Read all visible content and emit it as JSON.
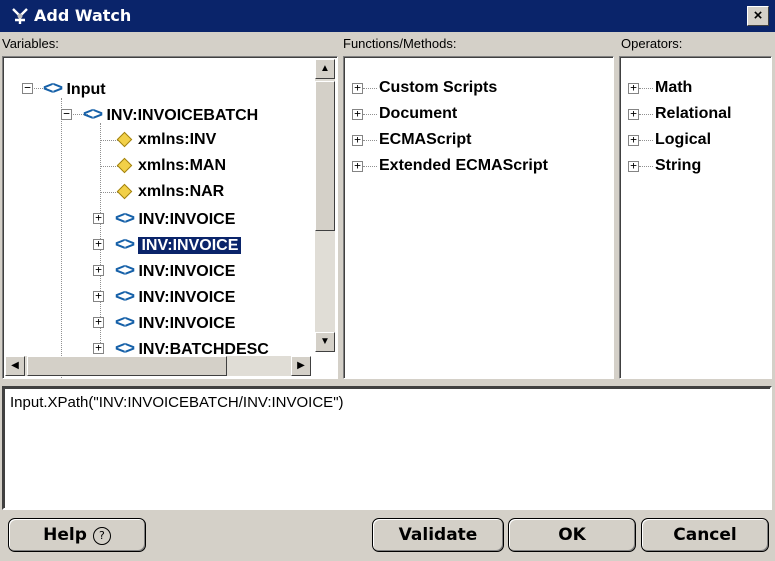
{
  "window": {
    "title": "Add Watch",
    "close_label": "×"
  },
  "variables": {
    "label": "Variables:",
    "tree": [
      {
        "icon": "tag-icon",
        "label": "Input",
        "expander": "−",
        "selected": false
      },
      {
        "icon": "tag-icon",
        "label": "INV:INVOICEBATCH",
        "expander": "−",
        "selected": false
      },
      {
        "icon": "attribute-icon",
        "label": "xmlns:INV",
        "expander": "",
        "selected": false
      },
      {
        "icon": "attribute-icon",
        "label": "xmlns:MAN",
        "expander": "",
        "selected": false
      },
      {
        "icon": "attribute-icon",
        "label": "xmlns:NAR",
        "expander": "",
        "selected": false
      },
      {
        "icon": "tag-icon",
        "label": "INV:INVOICE",
        "expander": "+",
        "selected": false
      },
      {
        "icon": "tag-icon",
        "label": "INV:INVOICE",
        "expander": "+",
        "selected": true
      },
      {
        "icon": "tag-icon",
        "label": "INV:INVOICE",
        "expander": "+",
        "selected": false
      },
      {
        "icon": "tag-icon",
        "label": "INV:INVOICE",
        "expander": "+",
        "selected": false
      },
      {
        "icon": "tag-icon",
        "label": "INV:INVOICE",
        "expander": "+",
        "selected": false
      },
      {
        "icon": "tag-icon",
        "label": "INV:BATCHDESC",
        "expander": "+",
        "selected": false
      }
    ]
  },
  "functions": {
    "label": "Functions/Methods:",
    "items": [
      {
        "label": "Custom Scripts",
        "expander": "+"
      },
      {
        "label": "Document",
        "expander": "+"
      },
      {
        "label": "ECMAScript",
        "expander": "+"
      },
      {
        "label": "Extended ECMAScript",
        "expander": "+"
      }
    ]
  },
  "operators": {
    "label": "Operators:",
    "items": [
      {
        "label": "Math",
        "expander": "+"
      },
      {
        "label": "Relational",
        "expander": "+"
      },
      {
        "label": "Logical",
        "expander": "+"
      },
      {
        "label": "String",
        "expander": "+"
      }
    ]
  },
  "expression": {
    "value": "Input.XPath(\"INV:INVOICEBATCH/INV:INVOICE\")"
  },
  "buttons": {
    "help": "Help",
    "help_glyph": "?",
    "validate": "Validate",
    "ok": "OK",
    "cancel": "Cancel"
  },
  "scroll": {
    "up": "▲",
    "down": "▼",
    "left": "◀",
    "right": "▶"
  },
  "colors": {
    "titlebar": "#0a246a",
    "selection": "#0a246a",
    "tag_icon": "#1560a8",
    "attr_icon": "#f2d048"
  }
}
